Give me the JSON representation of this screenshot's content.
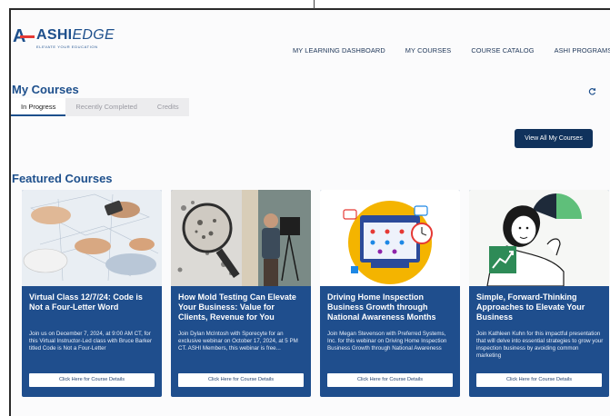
{
  "header": {
    "logo_text_bold": "ASHI",
    "logo_text_italic": "EDGE",
    "logo_tagline": "ELEVATE YOUR EDUCATION",
    "nav": [
      {
        "label": "MY LEARNING DASHBOARD"
      },
      {
        "label": "MY COURSES"
      },
      {
        "label": "COURSE CATALOG"
      },
      {
        "label": "ASHI PROGRAMS"
      }
    ]
  },
  "my_courses": {
    "title": "My Courses",
    "tabs": [
      {
        "label": "In Progress",
        "active": true
      },
      {
        "label": "Recently Completed",
        "active": false
      },
      {
        "label": "Credits",
        "active": false
      }
    ],
    "view_all_label": "View All My Courses",
    "refresh_icon": "refresh-icon"
  },
  "featured": {
    "title": "Featured Courses",
    "cards": [
      {
        "title": "Virtual Class 12/7/24: Code is Not a Four-Letter Word",
        "description": "Join us on December 7, 2024, at 9:00 AM CT, for this Virtual Instructor-Led class with Bruce Barker titled Code is Not a Four-Letter",
        "button_label": "Click Here for Course Details",
        "image": "blueprint-hands-image"
      },
      {
        "title": "How Mold Testing Can Elevate Your Business: Value for Clients, Revenue for You",
        "description": "Join Dylan McIntosh with Sporecyte for an exclusive webinar on October 17, 2024, at 5 PM CT. ASHI Members, this webinar is free...",
        "button_label": "Click Here for Course Details",
        "image": "mold-inspection-image"
      },
      {
        "title": "Driving Home Inspection Business Growth through National Awareness Months",
        "description": "Join Megan Stevenson with Preferred Systems, Inc. for this webinar on Driving Home Inspection Business Growth through National Awareness",
        "button_label": "Click Here for Course Details",
        "image": "awareness-calendar-illustration"
      },
      {
        "title": "Simple, Forward-Thinking Approaches to Elevate Your Business",
        "description": "Join Kathleen Kuhn for this impactful presentation that will delve into essential strategies to grow your inspection business by avoiding common marketing",
        "button_label": "Click Here for Course Details",
        "image": "growth-thinking-illustration"
      }
    ]
  },
  "colors": {
    "brand_blue": "#1d4f8c",
    "card_blue": "#1f4e8d",
    "dark_button": "#10325c",
    "logo_red": "#e53935"
  }
}
